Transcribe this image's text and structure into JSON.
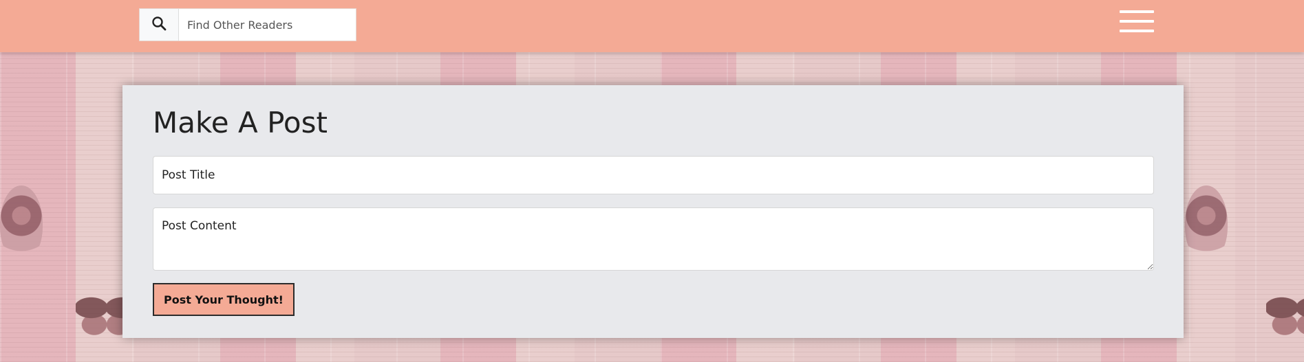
{
  "header": {
    "search": {
      "placeholder": "Find Other Readers",
      "value": ""
    },
    "icons": {
      "search": "search-icon",
      "menu": "hamburger-menu-icon"
    }
  },
  "post_form": {
    "heading": "Make A Post",
    "title_placeholder": "Post Title",
    "content_placeholder": "Post Content",
    "submit_label": "Post Your Thought!"
  },
  "colors": {
    "accent": "#f4aa95",
    "card_bg": "#e8e9ec",
    "header_bg": "#f4aa95"
  }
}
